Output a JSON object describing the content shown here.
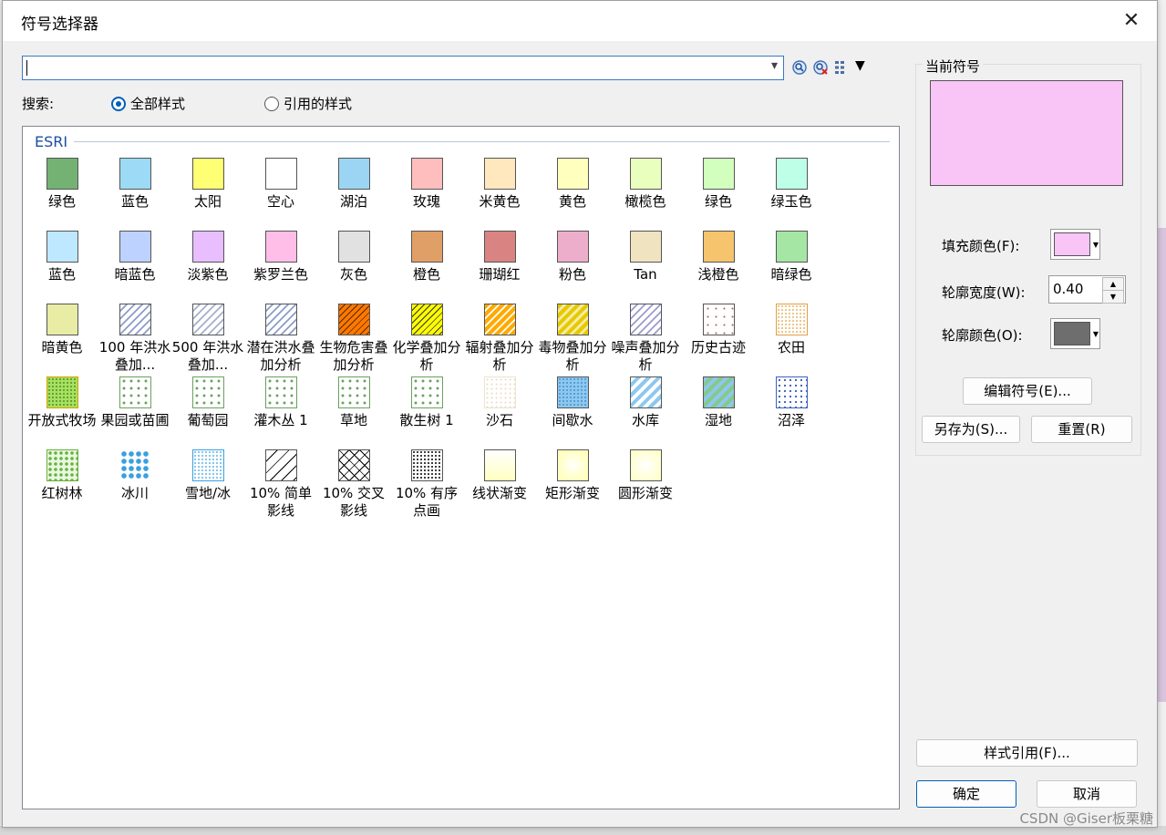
{
  "dialog": {
    "title": "符号选择器",
    "close_glyph": "✕"
  },
  "search": {
    "value": "",
    "label": "搜索:",
    "options": [
      "全部样式",
      "引用的样式"
    ],
    "selected": "全部样式"
  },
  "toolbar": {
    "icons": [
      "search-icon",
      "clear-search-icon",
      "view-options-icon"
    ],
    "dropdown_glyph": "▾",
    "view_menu_glyph": "▼"
  },
  "gallery": {
    "group_title": "ESRI",
    "rows": [
      [
        {
          "label": "绿色",
          "color": "#73b273",
          "icon": "solid"
        },
        {
          "label": "蓝色",
          "color": "#9cdaf5",
          "icon": "solid"
        },
        {
          "label": "太阳",
          "color": "#ffff73",
          "icon": "solid"
        },
        {
          "label": "空心",
          "color": "#ffffff",
          "icon": "solid"
        },
        {
          "label": "湖泊",
          "color": "#9bd5f3",
          "icon": "solid"
        },
        {
          "label": "玫瑰",
          "color": "#ffbebe",
          "icon": "solid"
        },
        {
          "label": "米黄色",
          "color": "#ffe8be",
          "icon": "solid"
        },
        {
          "label": "黄色",
          "color": "#ffffbe",
          "icon": "solid"
        },
        {
          "label": "橄榄色",
          "color": "#e9ffbe",
          "icon": "solid"
        },
        {
          "label": "绿色",
          "color": "#d3ffbe",
          "icon": "solid"
        },
        {
          "label": "绿玉色",
          "color": "#beffe8",
          "icon": "solid"
        }
      ],
      [
        {
          "label": "蓝色",
          "color": "#bee8ff",
          "icon": "solid"
        },
        {
          "label": "暗蓝色",
          "color": "#bed2ff",
          "icon": "solid"
        },
        {
          "label": "淡紫色",
          "color": "#e8beff",
          "icon": "solid"
        },
        {
          "label": "紫罗兰色",
          "color": "#ffbee8",
          "icon": "solid"
        },
        {
          "label": "灰色",
          "color": "#e1e1e1",
          "icon": "solid"
        },
        {
          "label": "橙色",
          "color": "#e09f67",
          "icon": "solid"
        },
        {
          "label": "珊瑚红",
          "color": "#d98383",
          "icon": "solid"
        },
        {
          "label": "粉色",
          "color": "#edaecb",
          "icon": "solid"
        },
        {
          "label": "Tan",
          "color": "#f0e3c0",
          "icon": "solid"
        },
        {
          "label": "浅橙色",
          "color": "#f5c46c",
          "icon": "solid"
        },
        {
          "label": "暗绿色",
          "color": "#a5e6a5",
          "icon": "solid"
        }
      ],
      [
        {
          "label": "暗黄色",
          "color": "#e8eca4",
          "icon": "solid"
        },
        {
          "label": "100 年洪水叠加...",
          "color": "#8c9cc8",
          "icon": "hatch-light"
        },
        {
          "label": "500 年洪水叠加...",
          "color": "#a4b0cc",
          "icon": "hatch-light"
        },
        {
          "label": "潜在洪水叠加分析",
          "color": "#8c9cc8",
          "icon": "hatch-light"
        },
        {
          "label": "生物危害叠加分析",
          "color": "#ff7800",
          "icon": "hatch-orange"
        },
        {
          "label": "化学叠加分析",
          "color": "#ffff00",
          "icon": "hatch-yellow"
        },
        {
          "label": "辐射叠加分析",
          "color": "#ffaa00",
          "icon": "hatch-amber"
        },
        {
          "label": "毒物叠加分析",
          "color": "#e6c800",
          "icon": "hatch-gold"
        },
        {
          "label": "噪声叠加分析",
          "color": "#9b9bd0",
          "icon": "hatch-purple"
        },
        {
          "label": "历史古迹",
          "color": "#b07040",
          "icon": "dots-brown"
        },
        {
          "label": "农田",
          "color": "#e0a040",
          "icon": "dots-amber"
        }
      ],
      [
        {
          "label": "开放式牧场",
          "color": "#a8e060",
          "icon": "dots-grass"
        },
        {
          "label": "果园或苗圃",
          "color": "#6aa060",
          "icon": "pattern-orchard"
        },
        {
          "label": "葡萄园",
          "color": "#6aa060",
          "icon": "pattern-vine"
        },
        {
          "label": "灌木丛 1",
          "color": "#6aa060",
          "icon": "pattern-scrub"
        },
        {
          "label": "草地",
          "color": "#6aa060",
          "icon": "pattern-grass"
        },
        {
          "label": "散生树 1",
          "color": "#6aa060",
          "icon": "pattern-trees"
        },
        {
          "label": "沙石",
          "color": "#e8dcc0",
          "icon": "dots-sand"
        },
        {
          "label": "间歇水",
          "color": "#8cc8f0",
          "icon": "dots-water"
        },
        {
          "label": "水库",
          "color": "#8cc8f0",
          "icon": "hatch-blue"
        },
        {
          "label": "湿地",
          "color": "#88c888",
          "icon": "hatch-wet"
        },
        {
          "label": "沼泽",
          "color": "#4060c0",
          "icon": "pattern-marsh"
        }
      ],
      [
        {
          "label": "红树林",
          "color": "#6ab040",
          "icon": "pattern-mangrove"
        },
        {
          "label": "冰川",
          "color": "#3aa0e0",
          "icon": "pattern-glacier"
        },
        {
          "label": "雪地/冰",
          "color": "#3aa0e0",
          "icon": "dots-snow"
        },
        {
          "label": "10% 简单影线",
          "color": "#000000",
          "icon": "hatch-simple"
        },
        {
          "label": "10% 交叉影线",
          "color": "#000000",
          "icon": "hatch-cross"
        },
        {
          "label": "10% 有序点画",
          "color": "#000000",
          "icon": "dots-ordered"
        },
        {
          "label": "线状渐变",
          "color": "#ffffc0",
          "icon": "grad-linear"
        },
        {
          "label": "矩形渐变",
          "color": "#ffffc0",
          "icon": "grad-rect"
        },
        {
          "label": "圆形渐变",
          "color": "#ffffc0",
          "icon": "grad-circle"
        }
      ]
    ]
  },
  "current_symbol": {
    "title": "当前符号",
    "preview_color": "#f9c5f7",
    "fill_color_label": "填充颜色(F):",
    "fill_color": "#f9c5f7",
    "outline_width_label": "轮廓宽度(W):",
    "outline_width": "0.40",
    "outline_color_label": "轮廓颜色(O):",
    "outline_color": "#6e6e6e",
    "edit_button": "编辑符号(E)...",
    "save_as_button": "另存为(S)...",
    "reset_button": "重置(R)"
  },
  "footer": {
    "style_refs_button": "样式引用(F)...",
    "ok_button": "确定",
    "cancel_button": "取消",
    "watermark": "CSDN @Giser板栗糖"
  }
}
